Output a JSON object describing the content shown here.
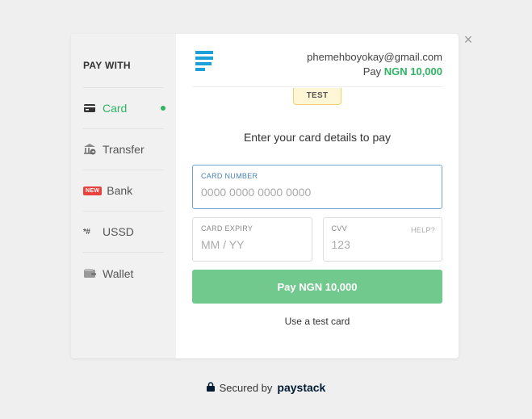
{
  "sidebar": {
    "title": "PAY WITH",
    "items": [
      {
        "label": "Card",
        "icon": "card-icon",
        "active": true
      },
      {
        "label": "Transfer",
        "icon": "bank-transfer-icon"
      },
      {
        "label": "Bank",
        "icon": "new-badge",
        "badge": "NEW"
      },
      {
        "label": "USSD",
        "icon": "ussd-icon",
        "icon_text": "*#"
      },
      {
        "label": "Wallet",
        "icon": "wallet-icon"
      }
    ]
  },
  "header": {
    "email": "phemehboyokay@gmail.com",
    "pay_prefix": "Pay",
    "amount": "NGN 10,000"
  },
  "test_badge": "TEST",
  "prompt": "Enter your card details to pay",
  "form": {
    "card_number_label": "CARD NUMBER",
    "card_number_placeholder": "0000 0000 0000 0000",
    "expiry_label": "CARD EXPIRY",
    "expiry_placeholder": "MM / YY",
    "cvv_label": "CVV",
    "cvv_help": "HELP?",
    "cvv_placeholder": "123"
  },
  "pay_button": "Pay NGN 10,000",
  "test_card_link": "Use a test card",
  "footer": {
    "secured_by": "Secured by",
    "brand": "paystack"
  },
  "colors": {
    "accent_green": "#2fb463",
    "pay_button": "#72c98e",
    "logo_blue": "#1ba0d8",
    "new_badge": "#e9433f"
  }
}
